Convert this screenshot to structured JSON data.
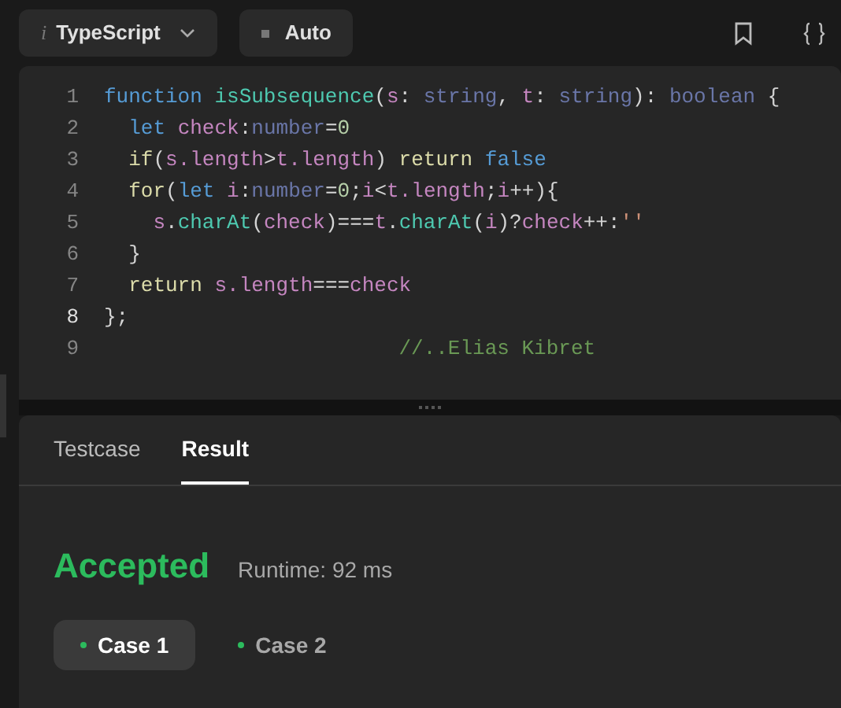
{
  "toolbar": {
    "language": {
      "icon": "i",
      "label": "TypeScript"
    },
    "mode": {
      "label": "Auto"
    }
  },
  "editor": {
    "lines": [
      {
        "number": "1",
        "active": false,
        "tokens": [
          {
            "kind": "keyword",
            "text": "function "
          },
          {
            "kind": "function",
            "text": "isSubsequence"
          },
          {
            "kind": "plain",
            "text": "("
          },
          {
            "kind": "variable",
            "text": "s"
          },
          {
            "kind": "plain",
            "text": ": "
          },
          {
            "kind": "type",
            "text": "string"
          },
          {
            "kind": "plain",
            "text": ", "
          },
          {
            "kind": "variable",
            "text": "t"
          },
          {
            "kind": "plain",
            "text": ": "
          },
          {
            "kind": "type",
            "text": "string"
          },
          {
            "kind": "plain",
            "text": "): "
          },
          {
            "kind": "type",
            "text": "boolean"
          },
          {
            "kind": "plain",
            "text": " {"
          }
        ]
      },
      {
        "number": "2",
        "active": false,
        "tokens": [
          {
            "kind": "keyword",
            "text": "  let "
          },
          {
            "kind": "variable",
            "text": "check"
          },
          {
            "kind": "plain",
            "text": ":"
          },
          {
            "kind": "type",
            "text": "number"
          },
          {
            "kind": "plain",
            "text": "="
          },
          {
            "kind": "number",
            "text": "0"
          }
        ]
      },
      {
        "number": "3",
        "active": false,
        "tokens": [
          {
            "kind": "control",
            "text": "  if"
          },
          {
            "kind": "plain",
            "text": "("
          },
          {
            "kind": "variable",
            "text": "s.length"
          },
          {
            "kind": "plain",
            "text": ">"
          },
          {
            "kind": "variable",
            "text": "t.length"
          },
          {
            "kind": "plain",
            "text": ") "
          },
          {
            "kind": "control",
            "text": "return "
          },
          {
            "kind": "keyword",
            "text": "false"
          }
        ]
      },
      {
        "number": "4",
        "active": false,
        "tokens": [
          {
            "kind": "control",
            "text": "  for"
          },
          {
            "kind": "plain",
            "text": "("
          },
          {
            "kind": "keyword",
            "text": "let "
          },
          {
            "kind": "variable",
            "text": "i"
          },
          {
            "kind": "plain",
            "text": ":"
          },
          {
            "kind": "type",
            "text": "number"
          },
          {
            "kind": "plain",
            "text": "="
          },
          {
            "kind": "number",
            "text": "0"
          },
          {
            "kind": "plain",
            "text": ";"
          },
          {
            "kind": "variable",
            "text": "i"
          },
          {
            "kind": "plain",
            "text": "<"
          },
          {
            "kind": "variable",
            "text": "t.length"
          },
          {
            "kind": "plain",
            "text": ";"
          },
          {
            "kind": "variable",
            "text": "i"
          },
          {
            "kind": "plain",
            "text": "++){"
          }
        ]
      },
      {
        "number": "5",
        "active": false,
        "tokens": [
          {
            "kind": "variable",
            "text": "    s"
          },
          {
            "kind": "plain",
            "text": "."
          },
          {
            "kind": "function",
            "text": "charAt"
          },
          {
            "kind": "plain",
            "text": "("
          },
          {
            "kind": "variable",
            "text": "check"
          },
          {
            "kind": "plain",
            "text": ")==="
          },
          {
            "kind": "variable",
            "text": "t"
          },
          {
            "kind": "plain",
            "text": "."
          },
          {
            "kind": "function",
            "text": "charAt"
          },
          {
            "kind": "plain",
            "text": "("
          },
          {
            "kind": "variable",
            "text": "i"
          },
          {
            "kind": "plain",
            "text": ")?"
          },
          {
            "kind": "variable",
            "text": "check"
          },
          {
            "kind": "plain",
            "text": "++:"
          },
          {
            "kind": "string",
            "text": "''"
          }
        ]
      },
      {
        "number": "6",
        "active": false,
        "tokens": [
          {
            "kind": "plain",
            "text": "  }"
          }
        ]
      },
      {
        "number": "7",
        "active": false,
        "tokens": [
          {
            "kind": "control",
            "text": "  return "
          },
          {
            "kind": "variable",
            "text": "s.length"
          },
          {
            "kind": "plain",
            "text": "==="
          },
          {
            "kind": "variable",
            "text": "check"
          }
        ]
      },
      {
        "number": "8",
        "active": true,
        "tokens": [
          {
            "kind": "plain",
            "text": "};"
          }
        ]
      },
      {
        "number": "9",
        "active": false,
        "tokens": [
          {
            "kind": "comment",
            "text": "                        //..Elias Kibret"
          }
        ]
      }
    ]
  },
  "result_panel": {
    "tabs": [
      {
        "label": "Testcase",
        "selected": false
      },
      {
        "label": "Result",
        "selected": true
      }
    ],
    "status": "Accepted",
    "runtime": "Runtime: 92 ms",
    "cases": [
      {
        "label": "Case 1",
        "selected": true,
        "color": "#2cbb5d"
      },
      {
        "label": "Case 2",
        "selected": false,
        "color": "#2cbb5d"
      }
    ]
  }
}
